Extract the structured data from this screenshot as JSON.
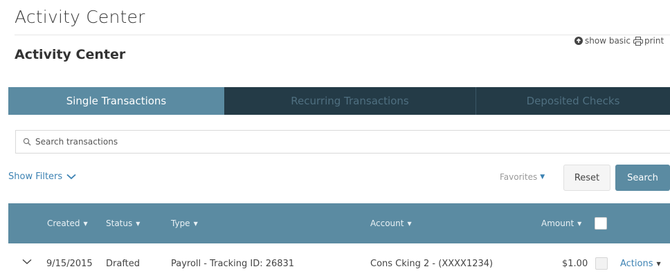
{
  "header": {
    "page_title": "Activity Center",
    "section_title": "Activity Center",
    "show_basic_label": "show basic",
    "print_label": "print"
  },
  "tabs": [
    {
      "label": "Single Transactions",
      "active": true
    },
    {
      "label": "Recurring Transactions",
      "active": false
    },
    {
      "label": "Deposited Checks",
      "active": false
    }
  ],
  "search": {
    "placeholder": "Search transactions",
    "value": ""
  },
  "filters": {
    "show_filters_label": "Show Filters",
    "favorites_label": "Favorites",
    "reset_label": "Reset",
    "search_label": "Search"
  },
  "table": {
    "columns": [
      {
        "label": "Created"
      },
      {
        "label": "Status"
      },
      {
        "label": "Type"
      },
      {
        "label": "Account"
      },
      {
        "label": "Amount"
      }
    ],
    "rows": [
      {
        "created": "9/15/2015",
        "status": "Drafted",
        "type": "Payroll - Tracking ID: 26831",
        "account": "Cons Cking 2 - (XXXX1234)",
        "amount": "$1.00",
        "actions_label": "Actions"
      }
    ]
  },
  "colors": {
    "tab_bar": "#243b47",
    "accent": "#5b8ba2",
    "link": "#3c82b3"
  },
  "icons": [
    "circle-arrow-icon",
    "printer-icon",
    "search-icon",
    "chevron-down-icon",
    "caret-down-icon"
  ]
}
